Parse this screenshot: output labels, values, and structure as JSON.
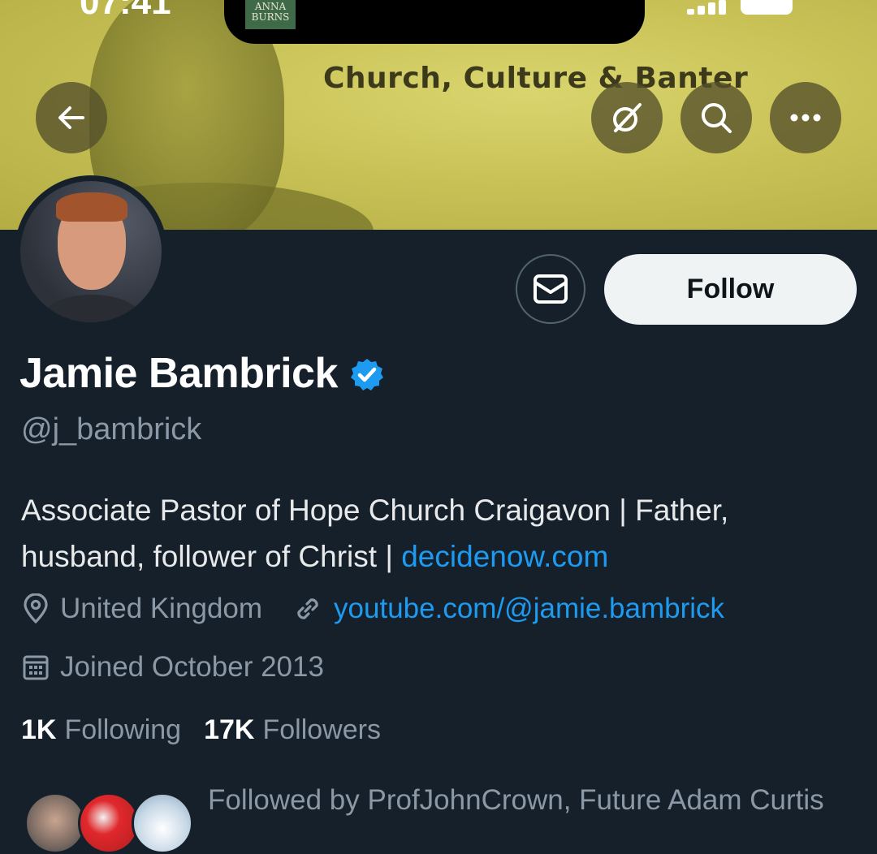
{
  "status_bar": {
    "time": "07:41"
  },
  "now_playing": {
    "thumb_text": "ANNA BURNS"
  },
  "banner": {
    "title": "Church, Culture & Banter"
  },
  "header_icons": [
    "back-arrow-icon",
    "grok-icon",
    "search-icon",
    "more-icon"
  ],
  "actions": {
    "follow_label": "Follow",
    "message_icon": "mail-icon"
  },
  "profile": {
    "name": "Jamie Bambrick",
    "handle": "@j_bambrick",
    "bio_text": "Associate Pastor of Hope Church Craigavon | Father, husband, follower of Christ | ",
    "bio_link": "decidenow.com",
    "location": "United Kingdom",
    "website": "youtube.com/@jamie.bambrick",
    "joined": "Joined October 2013"
  },
  "stats": {
    "following_count": "1K",
    "following_label": "Following",
    "followers_count": "17K",
    "followers_label": "Followers"
  },
  "followed_by": {
    "text": "Followed by ProfJohnCrown, Future Adam Curtis"
  },
  "colors": {
    "background": "#15202b",
    "accent_link": "#1d9bf0",
    "muted_text": "#8b98a5",
    "banner": "#c9c257"
  }
}
